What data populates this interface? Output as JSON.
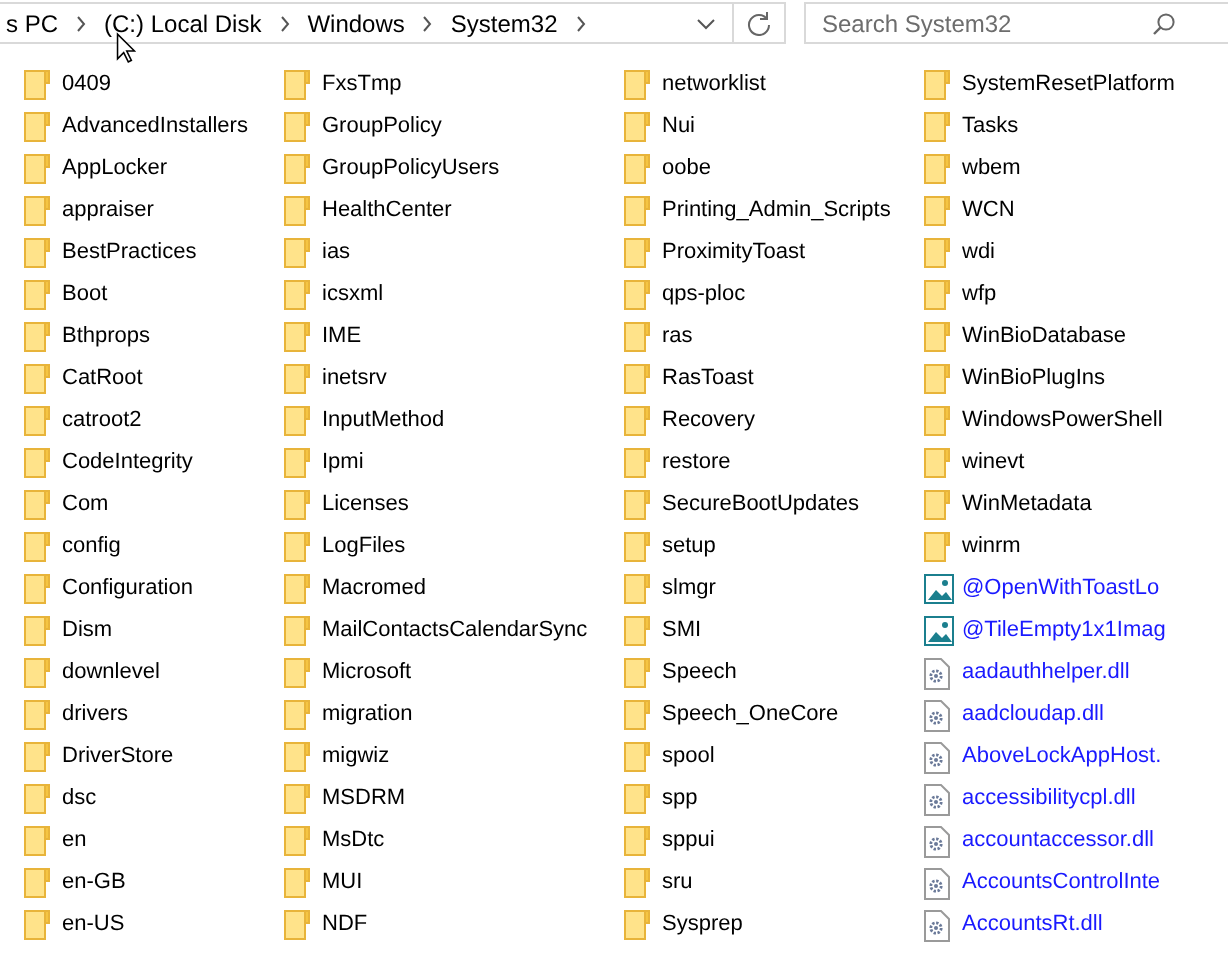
{
  "address_bar": {
    "segments": [
      "s PC",
      "(C:) Local Disk",
      "Windows",
      "System32"
    ]
  },
  "search": {
    "placeholder": "Search System32"
  },
  "columns": [
    {
      "items": [
        {
          "name": "0409",
          "kind": "folder",
          "compressed": false
        },
        {
          "name": "AdvancedInstallers",
          "kind": "folder",
          "compressed": false
        },
        {
          "name": "AppLocker",
          "kind": "folder",
          "compressed": false
        },
        {
          "name": "appraiser",
          "kind": "folder",
          "compressed": false
        },
        {
          "name": "BestPractices",
          "kind": "folder",
          "compressed": false
        },
        {
          "name": "Boot",
          "kind": "folder",
          "compressed": false
        },
        {
          "name": "Bthprops",
          "kind": "folder",
          "compressed": false
        },
        {
          "name": "CatRoot",
          "kind": "folder",
          "compressed": false
        },
        {
          "name": "catroot2",
          "kind": "folder",
          "compressed": false
        },
        {
          "name": "CodeIntegrity",
          "kind": "folder",
          "compressed": false
        },
        {
          "name": "Com",
          "kind": "folder",
          "compressed": false
        },
        {
          "name": "config",
          "kind": "folder",
          "compressed": false
        },
        {
          "name": "Configuration",
          "kind": "folder",
          "compressed": false
        },
        {
          "name": "Dism",
          "kind": "folder",
          "compressed": false
        },
        {
          "name": "downlevel",
          "kind": "folder",
          "compressed": false
        },
        {
          "name": "drivers",
          "kind": "folder",
          "compressed": false
        },
        {
          "name": "DriverStore",
          "kind": "folder",
          "compressed": false
        },
        {
          "name": "dsc",
          "kind": "folder",
          "compressed": false
        },
        {
          "name": "en",
          "kind": "folder",
          "compressed": false
        },
        {
          "name": "en-GB",
          "kind": "folder",
          "compressed": false
        },
        {
          "name": "en-US",
          "kind": "folder",
          "compressed": false
        }
      ]
    },
    {
      "items": [
        {
          "name": "FxsTmp",
          "kind": "folder",
          "compressed": false
        },
        {
          "name": "GroupPolicy",
          "kind": "folder",
          "compressed": false
        },
        {
          "name": "GroupPolicyUsers",
          "kind": "folder",
          "compressed": false
        },
        {
          "name": "HealthCenter",
          "kind": "folder",
          "compressed": false
        },
        {
          "name": "ias",
          "kind": "folder",
          "compressed": false
        },
        {
          "name": "icsxml",
          "kind": "folder",
          "compressed": false
        },
        {
          "name": "IME",
          "kind": "folder",
          "compressed": false
        },
        {
          "name": "inetsrv",
          "kind": "folder",
          "compressed": false
        },
        {
          "name": "InputMethod",
          "kind": "folder",
          "compressed": false
        },
        {
          "name": "Ipmi",
          "kind": "folder",
          "compressed": false
        },
        {
          "name": "Licenses",
          "kind": "folder",
          "compressed": false
        },
        {
          "name": "LogFiles",
          "kind": "folder",
          "compressed": false
        },
        {
          "name": "Macromed",
          "kind": "folder",
          "compressed": false
        },
        {
          "name": "MailContactsCalendarSync",
          "kind": "folder",
          "compressed": false
        },
        {
          "name": "Microsoft",
          "kind": "folder",
          "compressed": false
        },
        {
          "name": "migration",
          "kind": "folder",
          "compressed": false
        },
        {
          "name": "migwiz",
          "kind": "folder",
          "compressed": false
        },
        {
          "name": "MSDRM",
          "kind": "folder",
          "compressed": false
        },
        {
          "name": "MsDtc",
          "kind": "folder",
          "compressed": false
        },
        {
          "name": "MUI",
          "kind": "folder",
          "compressed": false
        },
        {
          "name": "NDF",
          "kind": "folder",
          "compressed": false
        }
      ]
    },
    {
      "items": [
        {
          "name": "networklist",
          "kind": "folder",
          "compressed": false
        },
        {
          "name": "Nui",
          "kind": "folder",
          "compressed": false
        },
        {
          "name": "oobe",
          "kind": "folder",
          "compressed": false
        },
        {
          "name": "Printing_Admin_Scripts",
          "kind": "folder",
          "compressed": false
        },
        {
          "name": "ProximityToast",
          "kind": "folder",
          "compressed": false
        },
        {
          "name": "qps-ploc",
          "kind": "folder",
          "compressed": false
        },
        {
          "name": "ras",
          "kind": "folder",
          "compressed": false
        },
        {
          "name": "RasToast",
          "kind": "folder",
          "compressed": false
        },
        {
          "name": "Recovery",
          "kind": "folder",
          "compressed": false
        },
        {
          "name": "restore",
          "kind": "folder",
          "compressed": false
        },
        {
          "name": "SecureBootUpdates",
          "kind": "folder",
          "compressed": false
        },
        {
          "name": "setup",
          "kind": "folder",
          "compressed": false
        },
        {
          "name": "slmgr",
          "kind": "folder",
          "compressed": false
        },
        {
          "name": "SMI",
          "kind": "folder",
          "compressed": false
        },
        {
          "name": "Speech",
          "kind": "folder",
          "compressed": false
        },
        {
          "name": "Speech_OneCore",
          "kind": "folder",
          "compressed": false
        },
        {
          "name": "spool",
          "kind": "folder",
          "compressed": false
        },
        {
          "name": "spp",
          "kind": "folder",
          "compressed": false
        },
        {
          "name": "sppui",
          "kind": "folder",
          "compressed": false
        },
        {
          "name": "sru",
          "kind": "folder",
          "compressed": false
        },
        {
          "name": "Sysprep",
          "kind": "folder",
          "compressed": false
        }
      ]
    },
    {
      "items": [
        {
          "name": "SystemResetPlatform",
          "kind": "folder",
          "compressed": false
        },
        {
          "name": "Tasks",
          "kind": "folder",
          "compressed": false
        },
        {
          "name": "wbem",
          "kind": "folder",
          "compressed": false
        },
        {
          "name": "WCN",
          "kind": "folder",
          "compressed": false
        },
        {
          "name": "wdi",
          "kind": "folder",
          "compressed": false
        },
        {
          "name": "wfp",
          "kind": "folder",
          "compressed": false
        },
        {
          "name": "WinBioDatabase",
          "kind": "folder",
          "compressed": false
        },
        {
          "name": "WinBioPlugIns",
          "kind": "folder",
          "compressed": false
        },
        {
          "name": "WindowsPowerShell",
          "kind": "folder",
          "compressed": false
        },
        {
          "name": "winevt",
          "kind": "folder",
          "compressed": false
        },
        {
          "name": "WinMetadata",
          "kind": "folder",
          "compressed": false
        },
        {
          "name": "winrm",
          "kind": "folder",
          "compressed": false
        },
        {
          "name": "@OpenWithToastLo",
          "kind": "image",
          "compressed": true
        },
        {
          "name": "@TileEmpty1x1Imag",
          "kind": "image",
          "compressed": true
        },
        {
          "name": "aadauthhelper.dll",
          "kind": "dll",
          "compressed": true
        },
        {
          "name": "aadcloudap.dll",
          "kind": "dll",
          "compressed": true
        },
        {
          "name": "AboveLockAppHost.",
          "kind": "dll",
          "compressed": true
        },
        {
          "name": "accessibilitycpl.dll",
          "kind": "dll",
          "compressed": true
        },
        {
          "name": "accountaccessor.dll",
          "kind": "dll",
          "compressed": true
        },
        {
          "name": "AccountsControlInte",
          "kind": "dll",
          "compressed": true
        },
        {
          "name": "AccountsRt.dll",
          "kind": "dll",
          "compressed": true
        }
      ]
    }
  ]
}
